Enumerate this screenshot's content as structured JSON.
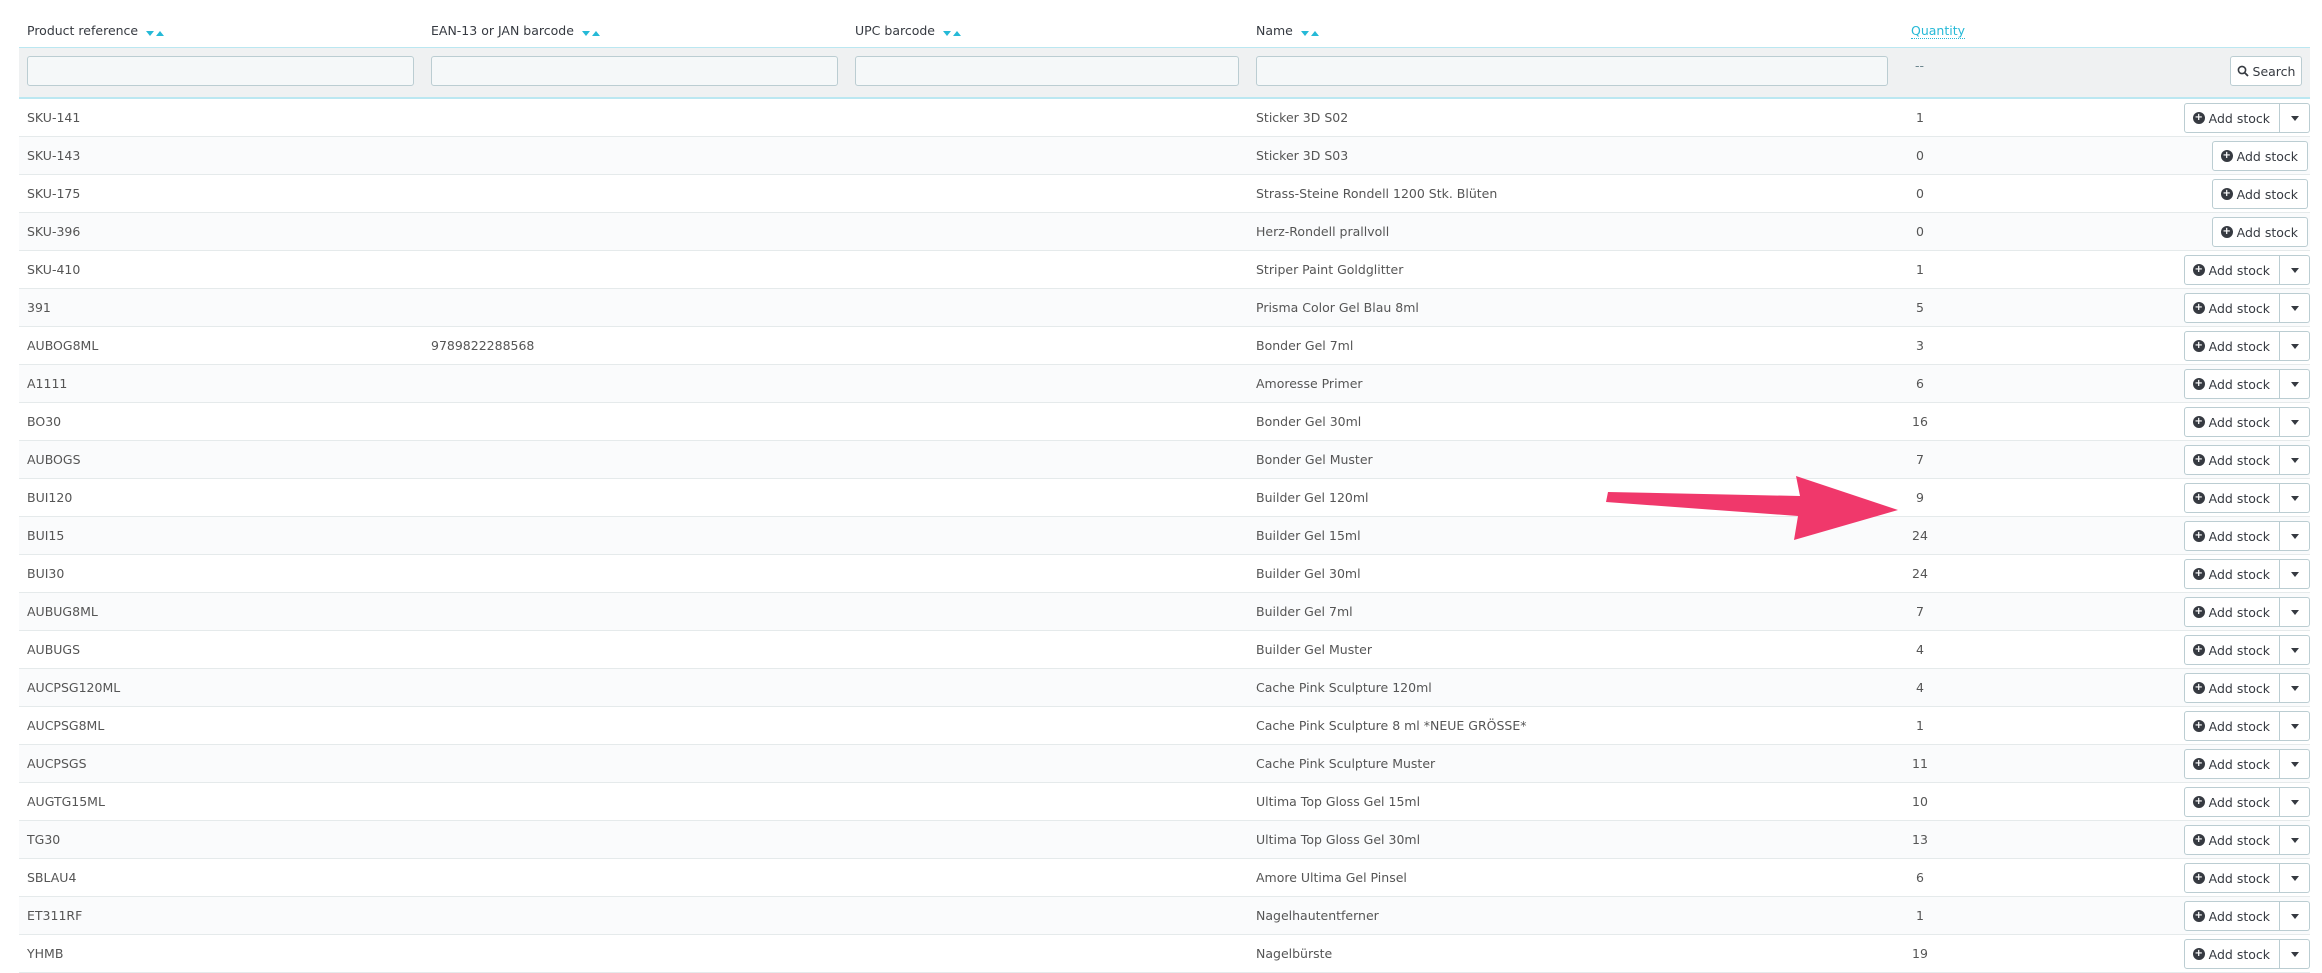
{
  "columns": {
    "ref": "Product reference",
    "ean": "EAN-13 or JAN barcode",
    "upc": "UPC barcode",
    "name": "Name",
    "qty": "Quantity"
  },
  "filters": {
    "qty_placeholder": "--",
    "search_label": "Search"
  },
  "add_stock_label": "Add stock",
  "rows": [
    {
      "ref": "SKU-141",
      "ean": "",
      "name": "Sticker 3D S02",
      "qty": "1",
      "dropdown": true
    },
    {
      "ref": "SKU-143",
      "ean": "",
      "name": "Sticker 3D S03",
      "qty": "0",
      "dropdown": false
    },
    {
      "ref": "SKU-175",
      "ean": "",
      "name": "Strass-Steine Rondell 1200 Stk. Blüten",
      "qty": "0",
      "dropdown": false
    },
    {
      "ref": "SKU-396",
      "ean": "",
      "name": "Herz-Rondell prallvoll",
      "qty": "0",
      "dropdown": false
    },
    {
      "ref": "SKU-410",
      "ean": "",
      "name": "Striper Paint Goldglitter",
      "qty": "1",
      "dropdown": true
    },
    {
      "ref": "391",
      "ean": "",
      "name": "Prisma Color Gel Blau 8ml",
      "qty": "5",
      "dropdown": true
    },
    {
      "ref": "AUBOG8ML",
      "ean": "9789822288568",
      "name": "Bonder Gel 7ml",
      "qty": "3",
      "dropdown": true
    },
    {
      "ref": "A1111",
      "ean": "",
      "name": "Amoresse Primer",
      "qty": "6",
      "dropdown": true
    },
    {
      "ref": "BO30",
      "ean": "",
      "name": "Bonder Gel 30ml",
      "qty": "16",
      "dropdown": true
    },
    {
      "ref": "AUBOGS",
      "ean": "",
      "name": "Bonder Gel Muster",
      "qty": "7",
      "dropdown": true
    },
    {
      "ref": "BUI120",
      "ean": "",
      "name": "Builder Gel 120ml",
      "qty": "9",
      "dropdown": true
    },
    {
      "ref": "BUI15",
      "ean": "",
      "name": "Builder Gel 15ml",
      "qty": "24",
      "dropdown": true
    },
    {
      "ref": "BUI30",
      "ean": "",
      "name": "Builder Gel 30ml",
      "qty": "24",
      "dropdown": true
    },
    {
      "ref": "AUBUG8ML",
      "ean": "",
      "name": "Builder Gel 7ml",
      "qty": "7",
      "dropdown": true
    },
    {
      "ref": "AUBUGS",
      "ean": "",
      "name": "Builder Gel Muster",
      "qty": "4",
      "dropdown": true
    },
    {
      "ref": "AUCPSG120ML",
      "ean": "",
      "name": "Cache Pink Sculpture 120ml",
      "qty": "4",
      "dropdown": true
    },
    {
      "ref": "AUCPSG8ML",
      "ean": "",
      "name": "Cache Pink Sculpture 8 ml *NEUE GRÖSSE*",
      "qty": "1",
      "dropdown": true
    },
    {
      "ref": "AUCPSGS",
      "ean": "",
      "name": "Cache Pink Sculpture Muster",
      "qty": "11",
      "dropdown": true
    },
    {
      "ref": "AUGTG15ML",
      "ean": "",
      "name": "Ultima Top Gloss Gel 15ml",
      "qty": "10",
      "dropdown": true
    },
    {
      "ref": "TG30",
      "ean": "",
      "name": "Ultima Top Gloss Gel 30ml",
      "qty": "13",
      "dropdown": true
    },
    {
      "ref": "SBLAU4",
      "ean": "",
      "name": "Amore Ultima Gel Pinsel",
      "qty": "6",
      "dropdown": true
    },
    {
      "ref": "ET311RF",
      "ean": "",
      "name": "Nagelhautentferner",
      "qty": "1",
      "dropdown": true
    },
    {
      "ref": "YHMB",
      "ean": "",
      "name": "Nagelbürste",
      "qty": "19",
      "dropdown": true
    }
  ],
  "colors": {
    "accent": "#25b9d7",
    "arrow": "#f0386b",
    "filter_bg": "#eff1f2"
  }
}
